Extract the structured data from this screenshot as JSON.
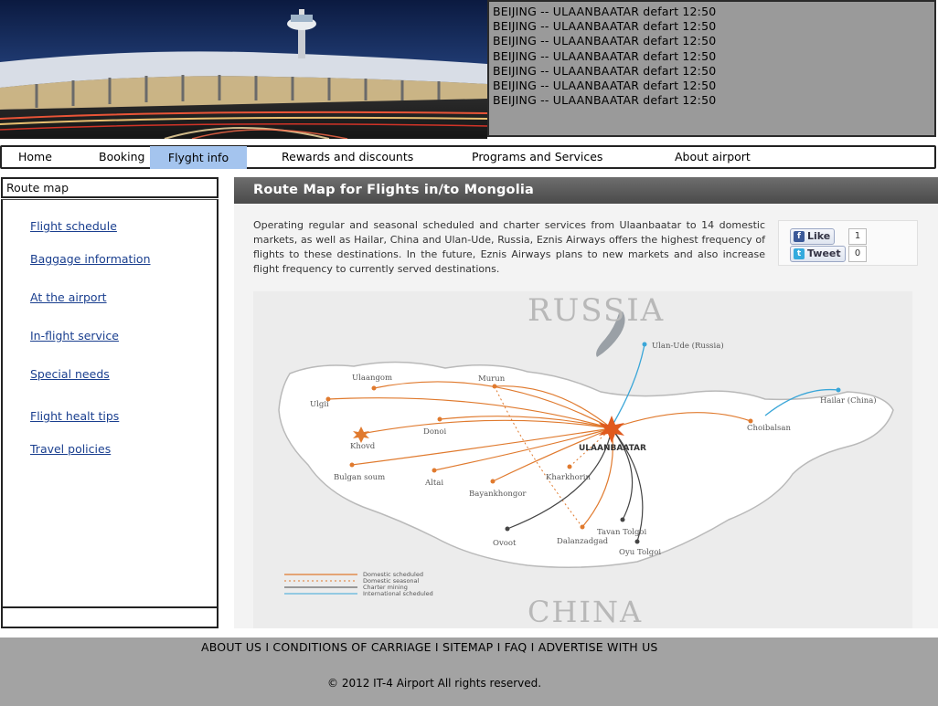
{
  "ticker": {
    "lines": [
      "BEIJING -- ULAANBAATAR defart 12:50",
      "BEIJING -- ULAANBAATAR defart 12:50",
      "BEIJING -- ULAANBAATAR defart 12:50",
      "BEIJING -- ULAANBAATAR defart 12:50",
      "BEIJING -- ULAANBAATAR defart 12:50",
      "BEIJING -- ULAANBAATAR defart 12:50",
      "BEIJING -- ULAANBAATAR defart 12:50"
    ]
  },
  "nav": {
    "items": [
      "Home",
      "Booking",
      "Flyght info",
      "Rewards and discounts",
      "Programs and Services",
      "About airport"
    ],
    "active_color": "#a4c4ee"
  },
  "sidebar": {
    "title": "Route map",
    "links": [
      "Flight schedule",
      "Baggage information",
      "At the airport",
      "In-flight service",
      "Special needs",
      "Flight healt tips",
      "Travel policies"
    ]
  },
  "content": {
    "title": "Route Map for Flights in/to Mongolia",
    "intro": "Operating regular and seasonal scheduled and charter services from Ulaanbaatar to 14 domestic markets, as well as Hailar, China and Ulan-Ude, Russia, Eznis Airways offers the highest frequency of flights to these destinations. In the future, Eznis Airways plans to new markets and also increase flight frequency to currently served destinations."
  },
  "social": {
    "like_label": "Like",
    "like_count": "1",
    "tweet_label": "Tweet",
    "tweet_count": "0"
  },
  "map": {
    "country_north": "RUSSIA",
    "country_south": "CHINA",
    "hub": "ULAANBAATAR",
    "cities": [
      "Ulan-Ude (Russia)",
      "Hailar (China)",
      "Ulaangom",
      "Murun",
      "Ulgii",
      "Khovd",
      "Donoi",
      "Choibalsan",
      "Kharkhorin",
      "Altai",
      "Bayankhongor",
      "Bulgan soum",
      "Ovoot",
      "Dalanzadgad",
      "Tavan Tolgoi",
      "Oyu Tolgoi"
    ],
    "legend": [
      "Domestic scheduled",
      "Domestic seasonal",
      "Charter mining",
      "International scheduled"
    ],
    "colors": {
      "domestic": "#e07a2e",
      "charter": "#444444",
      "international": "#3aa6d8"
    }
  },
  "footer": {
    "links": [
      "ABOUT US",
      "CONDITIONS OF CARRIAGE",
      "SITEMAP",
      "FAQ",
      "ADVERTISE WITH US"
    ],
    "separator": " I ",
    "copyright": "© 2012 IT-4 Airport All rights reserved."
  }
}
